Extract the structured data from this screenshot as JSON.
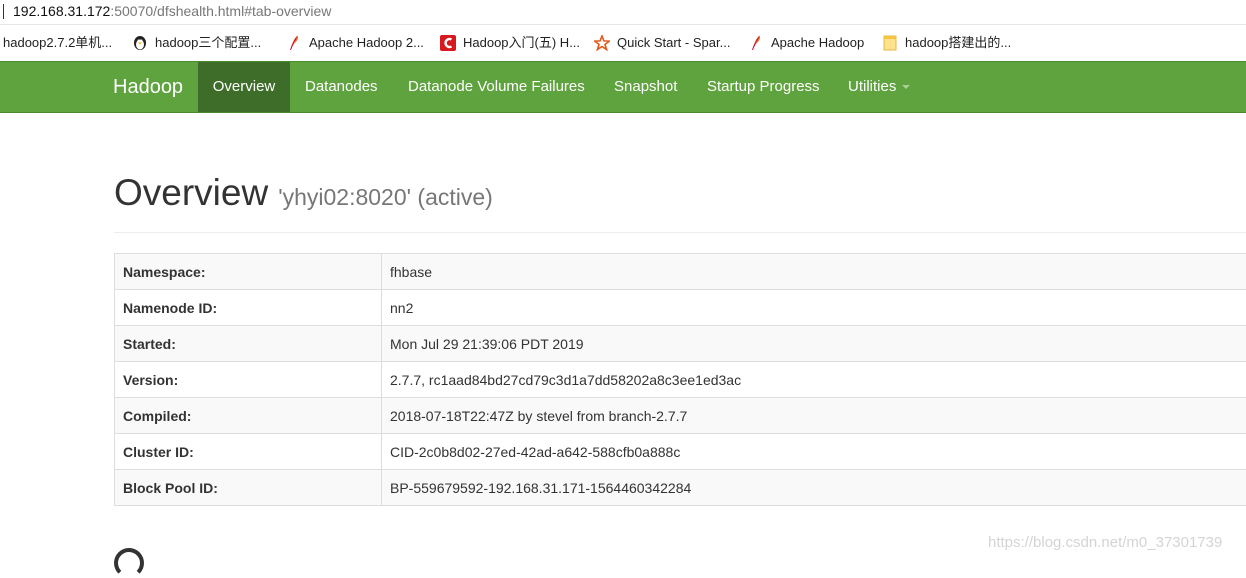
{
  "address_bar": {
    "host": "192.168.31.172",
    "path": ":50070/dfshealth.html#tab-overview"
  },
  "bookmarks": [
    {
      "label": "hadoop2.7.2单机...",
      "icon": "none"
    },
    {
      "label": "hadoop三个配置...",
      "icon": "penguin-icon"
    },
    {
      "label": "Apache Hadoop 2...",
      "icon": "feather-icon"
    },
    {
      "label": "Hadoop入门(五) H...",
      "icon": "csdn-icon"
    },
    {
      "label": "Quick Start - Spar...",
      "icon": "spark-star-icon"
    },
    {
      "label": "Apache Hadoop",
      "icon": "feather-icon"
    },
    {
      "label": "hadoop搭建出的...",
      "icon": "note-icon"
    }
  ],
  "navbar": {
    "brand": "Hadoop",
    "items": [
      {
        "label": "Overview",
        "active": true
      },
      {
        "label": "Datanodes",
        "active": false
      },
      {
        "label": "Datanode Volume Failures",
        "active": false
      },
      {
        "label": "Snapshot",
        "active": false
      },
      {
        "label": "Startup Progress",
        "active": false
      },
      {
        "label": "Utilities",
        "active": false,
        "dropdown": true
      }
    ],
    "color": "#5fa33e",
    "active_color": "#3e6d2a"
  },
  "overview": {
    "title": "Overview",
    "subtitle": "'yhyi02:8020' (active)",
    "rows": [
      {
        "key": "Namespace:",
        "value": "fhbase"
      },
      {
        "key": "Namenode ID:",
        "value": "nn2"
      },
      {
        "key": "Started:",
        "value": "Mon Jul 29 21:39:06 PDT 2019"
      },
      {
        "key": "Version:",
        "value": "2.7.7, rc1aad84bd27cd79c3d1a7dd58202a8c3ee1ed3ac"
      },
      {
        "key": "Compiled:",
        "value": "2018-07-18T22:47Z by stevel from branch-2.7.7"
      },
      {
        "key": "Cluster ID:",
        "value": "CID-2c0b8d02-27ed-42ad-a642-588cfb0a888c"
      },
      {
        "key": "Block Pool ID:",
        "value": "BP-559679592-192.168.31.171-1564460342284"
      }
    ]
  },
  "watermark": "https://blog.csdn.net/m0_37301739"
}
